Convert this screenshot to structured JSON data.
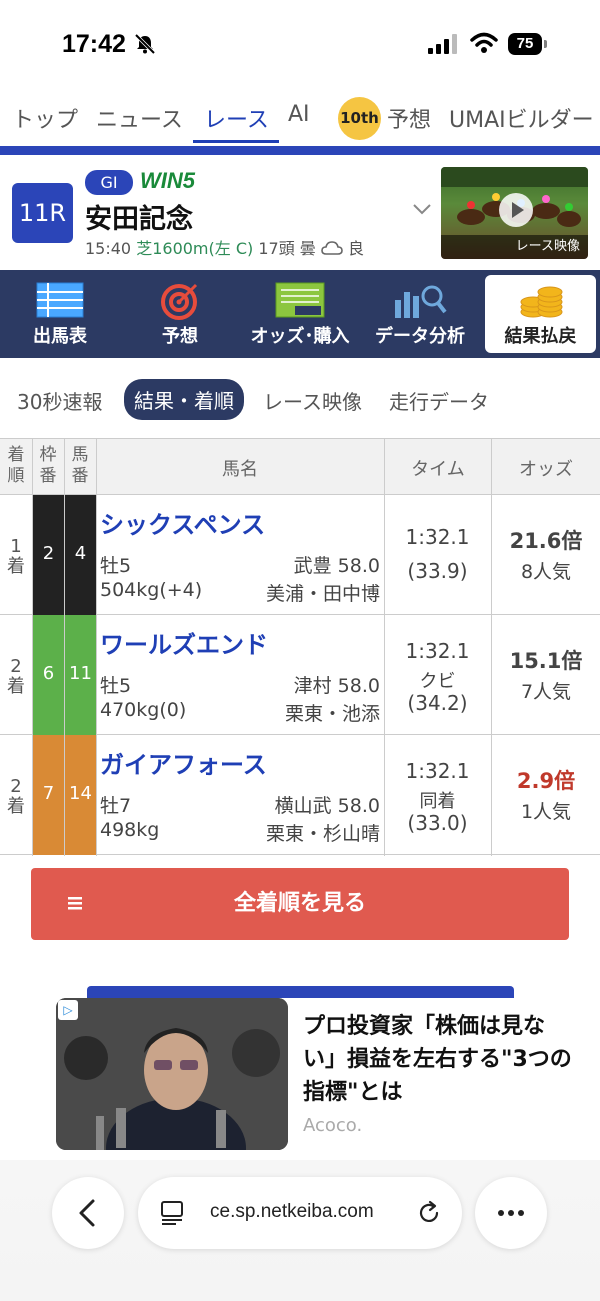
{
  "status": {
    "time": "17:42",
    "battery": "75"
  },
  "topnav": {
    "items": [
      "トップ",
      "ニュース",
      "レース",
      "AI",
      "予想",
      "UMAIビルダー"
    ],
    "badge": "10th",
    "active": "レース"
  },
  "race": {
    "number": "11R",
    "grade": "GI",
    "win5": "WIN5",
    "name": "安田記念",
    "info_time": "15:40",
    "info_course": "芝1600m(左 C)",
    "info_rest": "17頭 曇",
    "info_going": "良",
    "video_label": "レース映像"
  },
  "menu": {
    "items": [
      "出馬表",
      "予想",
      "オッズ･購入",
      "データ分析",
      "結果払戻"
    ],
    "selected": "結果払戻"
  },
  "subtabs": {
    "items": [
      "30秒速報",
      "結果・着順",
      "レース映像",
      "走行データ"
    ],
    "active": "結果・着順"
  },
  "table": {
    "headers": {
      "rank": "着順",
      "waku": "枠番",
      "umaban": "馬番",
      "name": "馬名",
      "time": "タイム",
      "odds": "オッズ"
    },
    "rows": [
      {
        "rank": "1",
        "rank_unit": "着",
        "waku": "2",
        "umaban": "4",
        "waku_color": "#222222",
        "name": "シックスペンス",
        "sexage": "牡5",
        "jockey": "武豊 58.0",
        "weight": "504kg(+4)",
        "trainer": "美浦・田中博",
        "time": "1:32.1",
        "margin": "",
        "last3f": "(33.9)",
        "odds": "21.6倍",
        "pop": "8人気",
        "odds_hot": false
      },
      {
        "rank": "2",
        "rank_unit": "着",
        "waku": "6",
        "umaban": "11",
        "waku_color": "#5cb04a",
        "name": "ワールズエンド",
        "sexage": "牡5",
        "jockey": "津村 58.0",
        "weight": "470kg(0)",
        "trainer": "栗東・池添",
        "time": "1:32.1",
        "margin": "クビ",
        "last3f": "(34.2)",
        "odds": "15.1倍",
        "pop": "7人気",
        "odds_hot": false
      },
      {
        "rank": "2",
        "rank_unit": "着",
        "waku": "7",
        "umaban": "14",
        "waku_color": "#d98a35",
        "name": "ガイアフォース",
        "sexage": "牡7",
        "jockey": "横山武 58.0",
        "weight": "498kg",
        "trainer": "栗東・杉山晴",
        "time": "1:32.1",
        "margin": "同着",
        "last3f": "(33.0)",
        "odds": "2.9倍",
        "pop": "1人気",
        "odds_hot": true
      }
    ]
  },
  "full_button": "全着順を見る",
  "ad": {
    "badge": "▷",
    "title": "プロ投資家「株価は見ない」損益を左右する\"3つの指標\"とは",
    "source": "Acoco."
  },
  "browser": {
    "url": "ce.sp.netkeiba.com"
  },
  "colors": {
    "brand": "#2b45b8",
    "menu_bg": "#2c3a63",
    "button": "#e05a4f",
    "hot_odds": "#c0392b"
  }
}
